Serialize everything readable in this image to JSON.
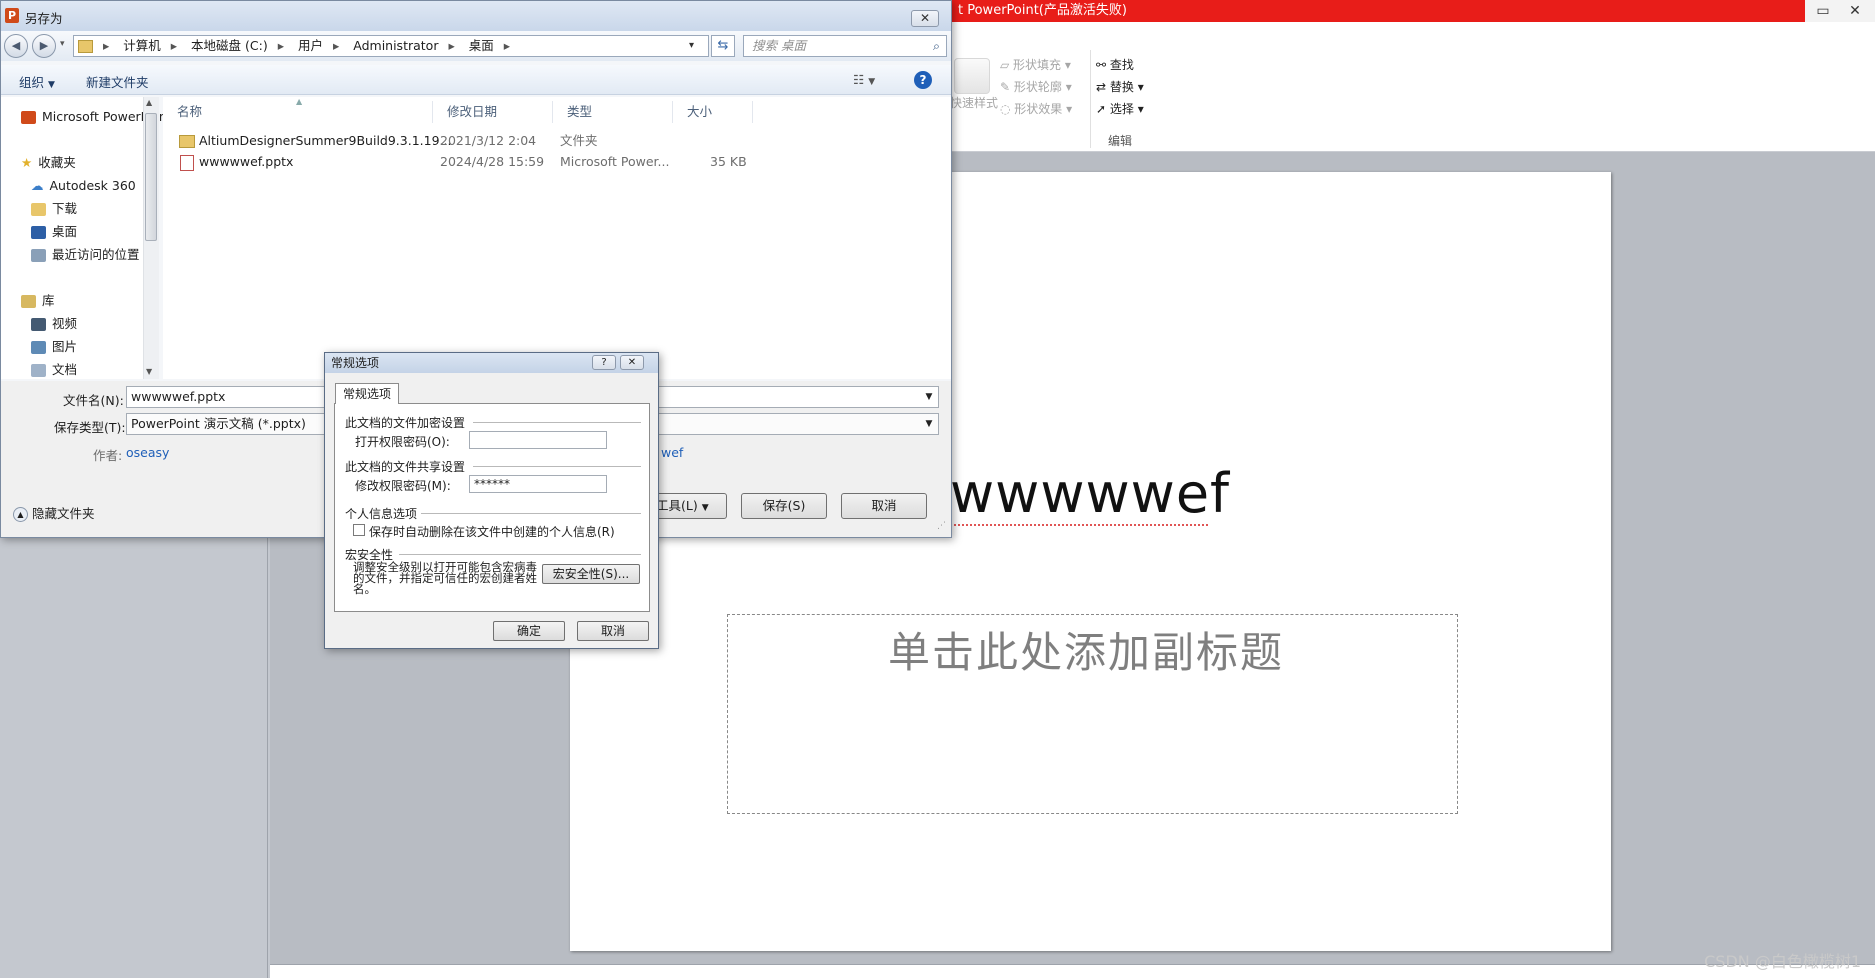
{
  "powerpoint": {
    "title": "t PowerPoint(产品激活失败)",
    "window_controls": [
      "▭",
      "✕"
    ],
    "ribbon": {
      "quick_styles": "快速样式",
      "shape_fill": "形状填充",
      "shape_outline": "形状轮廓",
      "shape_effects": "形状效果",
      "find": "查找",
      "replace": "替换",
      "select": "选择",
      "editing_group": "编辑"
    },
    "slide": {
      "title_text": "wwwwwef",
      "subtitle_placeholder": "单击此处添加副标题"
    },
    "watermark": "CSDN @白色橄榄树1"
  },
  "save_as": {
    "title": "另存为",
    "close_label": "✕",
    "address_parts": [
      "计算机",
      "本地磁盘 (C:)",
      "用户",
      "Administrator",
      "桌面"
    ],
    "search_placeholder": "搜索 桌面",
    "toolbar": {
      "organize": "组织",
      "new_folder": "新建文件夹"
    },
    "nav_items": [
      {
        "label": "Microsoft PowerPoint",
        "icon": "powerpoint-icon"
      },
      {
        "label": "收藏夹",
        "icon": "favorites-star-icon"
      },
      {
        "label": "Autodesk 360",
        "icon": "cloud-icon"
      },
      {
        "label": "下载",
        "icon": "download-folder-icon"
      },
      {
        "label": "桌面",
        "icon": "desktop-icon"
      },
      {
        "label": "最近访问的位置",
        "icon": "recent-places-icon"
      },
      {
        "label": "库",
        "icon": "library-icon"
      },
      {
        "label": "视频",
        "icon": "video-icon"
      },
      {
        "label": "图片",
        "icon": "pictures-icon"
      },
      {
        "label": "文档",
        "icon": "documents-icon"
      }
    ],
    "columns": [
      "名称",
      "修改日期",
      "类型",
      "大小"
    ],
    "files": [
      {
        "name": "AltiumDesignerSummer9Build9.3.1.19...",
        "date": "2021/3/12 2:04",
        "type": "文件夹",
        "size": ""
      },
      {
        "name": "wwwwwef.pptx",
        "date": "2024/4/28 15:59",
        "type": "Microsoft Power...",
        "size": "35 KB"
      }
    ],
    "filename_label": "文件名(N):",
    "filename_value": "wwwwwef.pptx",
    "filetype_label": "保存类型(T):",
    "filetype_value": "PowerPoint 演示文稿 (*.pptx)",
    "author_label": "作者:",
    "author_value": "oseasy",
    "title_partial": "wef",
    "tools_label": "工具(L)",
    "save_button": "保存(S)",
    "cancel_button": "取消",
    "hide_folders": "隐藏文件夹"
  },
  "general_options": {
    "title": "常规选项",
    "help_label": "?",
    "close_label": "✕",
    "tab": "常规选项",
    "encrypt_header": "此文档的文件加密设置",
    "open_password_label": "打开权限密码(O):",
    "open_password_value": "",
    "share_header": "此文档的文件共享设置",
    "modify_password_label": "修改权限密码(M):",
    "modify_password_value": "******",
    "privacy_header": "个人信息选项",
    "remove_info_label": "保存时自动删除在该文件中创建的个人信息(R)",
    "macro_header": "宏安全性",
    "macro_text": "调整安全级别以打开可能包含宏病毒的文件，并指定可信任的宏创建者姓名。",
    "macro_button": "宏安全性(S)...",
    "ok_button": "确定",
    "cancel_button": "取消"
  }
}
